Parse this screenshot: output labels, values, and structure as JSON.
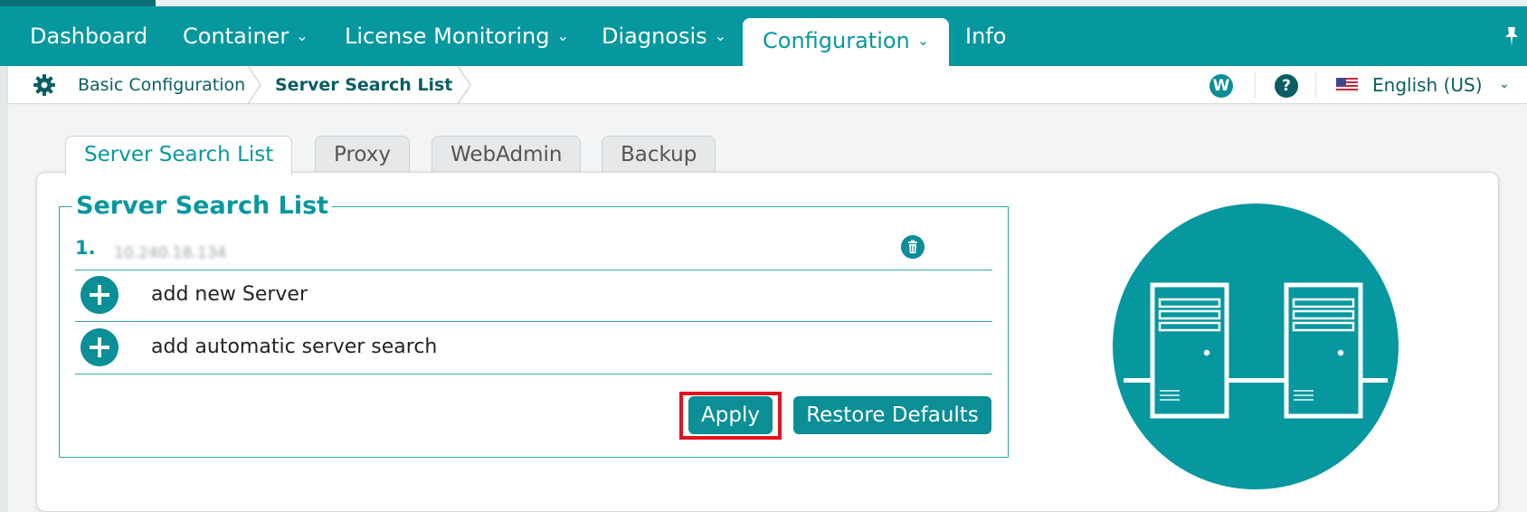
{
  "nav": {
    "items": [
      {
        "label": "Dashboard",
        "has_menu": false
      },
      {
        "label": "Container",
        "has_menu": true
      },
      {
        "label": "License Monitoring",
        "has_menu": true
      },
      {
        "label": "Diagnosis",
        "has_menu": true
      },
      {
        "label": "Configuration",
        "has_menu": true,
        "active": true
      },
      {
        "label": "Info",
        "has_menu": false
      }
    ],
    "pin_icon": "pin-icon"
  },
  "breadcrumb": {
    "icon": "gear-icon",
    "items": [
      "Basic Configuration",
      "Server Search List"
    ]
  },
  "header_tools": {
    "webadmin_badge": "W",
    "help_icon": "?",
    "language": {
      "flag_icon": "us-flag-icon",
      "selected": "English (US)"
    }
  },
  "tabs": [
    {
      "label": "Server Search List",
      "active": true
    },
    {
      "label": "Proxy",
      "active": false
    },
    {
      "label": "WebAdmin",
      "active": false
    },
    {
      "label": "Backup",
      "active": false
    }
  ],
  "server_list": {
    "legend": "Server Search List",
    "entries": [
      {
        "number": "1.",
        "value": "10.240.18.134",
        "delete_icon": "trash-icon"
      }
    ],
    "add_new_server": "add new Server",
    "add_automatic": "add automatic server search"
  },
  "buttons": {
    "apply": "Apply",
    "restore_defaults": "Restore Defaults"
  },
  "colors": {
    "primary": "#07979f",
    "accent_dark": "#0b8e96",
    "highlight": "#e0141e"
  }
}
